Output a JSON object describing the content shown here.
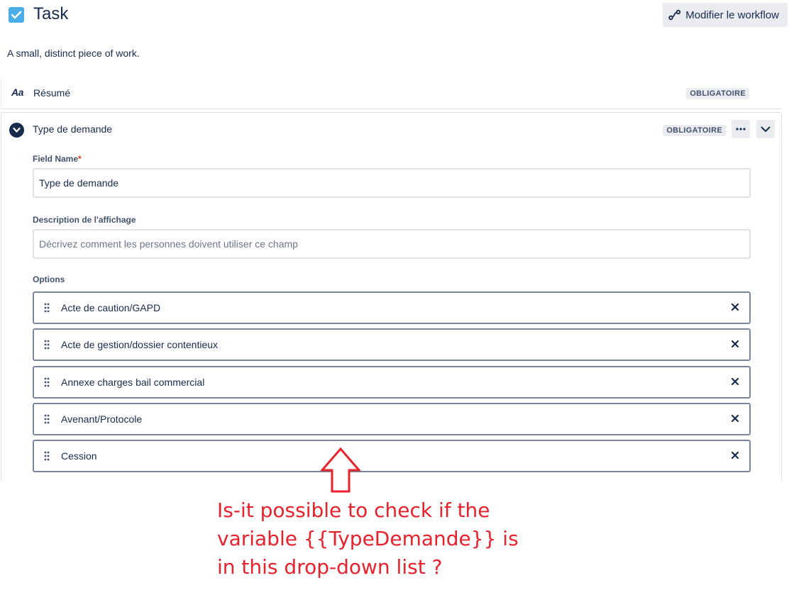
{
  "header": {
    "title": "Task",
    "workflow_button": "Modifier le workflow"
  },
  "description": "A small, distinct piece of work.",
  "summary_field": {
    "icon_text": "Aa",
    "label": "Résumé",
    "badge": "OBLIGATOIRE"
  },
  "request_type_field": {
    "title": "Type de demande",
    "badge": "OBLIGATOIRE",
    "field_name_label": "Field Name",
    "required_marker": "*",
    "field_name_value": "Type de demande",
    "display_desc_label": "Description de l'affichage",
    "display_desc_placeholder": "Décrivez comment les personnes doivent utiliser ce champ",
    "options_label": "Options",
    "options": [
      "Acte de caution/GAPD",
      "Acte de gestion/dossier contentieux",
      "Annexe charges bail commercial",
      "Avenant/Protocole",
      "Cession"
    ]
  },
  "annotation": {
    "line1": "Is-it possible to check if the",
    "line2": "variable {{TypeDemande}} is",
    "line3": "in this drop-down list ?",
    "color": "#e8212b"
  }
}
